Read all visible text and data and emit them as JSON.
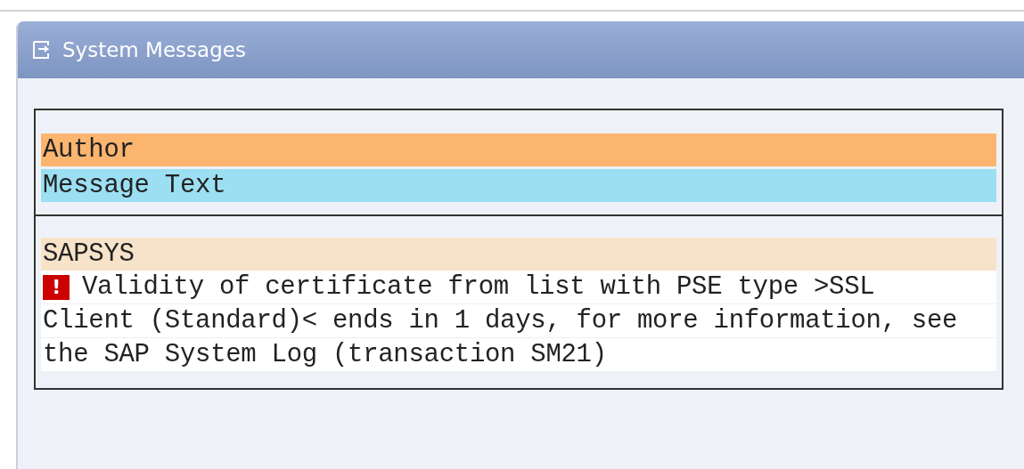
{
  "window": {
    "title": "System Messages"
  },
  "header": {
    "author_label": "Author",
    "message_label": "Message Text"
  },
  "messages": [
    {
      "author": "SAPSYS",
      "kind": "error",
      "icon_text": "!",
      "lines": [
        "Validity of certificate from list with PSE type >SSL",
        "Client (Standard)< ends in 1 days, for more information, see",
        "the SAP System Log (transaction SM21)"
      ]
    }
  ]
}
